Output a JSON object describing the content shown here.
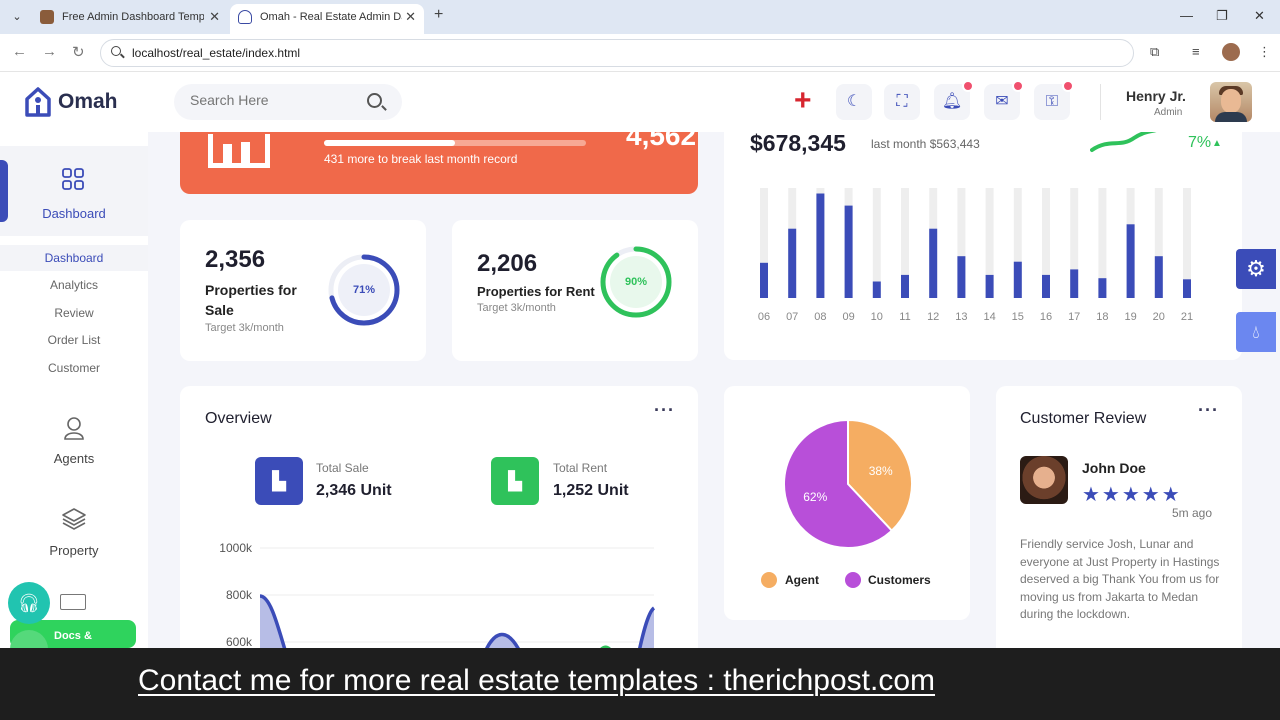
{
  "browser": {
    "tabs": [
      {
        "title": "Free Admin Dashboard Templa",
        "active": false
      },
      {
        "title": "Omah - Real Estate Admin Das",
        "active": true
      }
    ],
    "url": "localhost/real_estate/index.html"
  },
  "header": {
    "brand": "Omah",
    "search_placeholder": "Search Here",
    "user_name": "Henry Jr.",
    "user_role": "Admin"
  },
  "sidebar": {
    "main_item": "Dashboard",
    "subitems": [
      "Dashboard",
      "Analytics",
      "Review",
      "Order List",
      "Customer"
    ],
    "active_subitem": "Dashboard",
    "items": [
      {
        "label": "Agents",
        "icon": "user-icon"
      },
      {
        "label": "Property",
        "icon": "layers-icon"
      }
    ],
    "docs_label": "Docs &"
  },
  "promo": {
    "value_partial": "4,562",
    "progress": 0.5,
    "message": "431 more to break last month record"
  },
  "stats": [
    {
      "value": "2,356",
      "title": "Properties for Sale",
      "target": "Target 3k/month",
      "percent": 71,
      "percent_label": "71%",
      "color": "#3b4cb8"
    },
    {
      "value": "2,206",
      "title": "Properties for Rent",
      "target": "Target 3k/month",
      "percent": 90,
      "percent_label": "90%",
      "color": "#2fc25b"
    }
  ],
  "revenue": {
    "amount": "$678,345",
    "last_month": "last month $563,443",
    "change": "7%"
  },
  "chart_data": [
    {
      "type": "bar",
      "categories": [
        "06",
        "07",
        "08",
        "09",
        "10",
        "11",
        "12",
        "13",
        "14",
        "15",
        "16",
        "17",
        "18",
        "19",
        "20",
        "21"
      ],
      "values": [
        32,
        63,
        95,
        84,
        15,
        21,
        63,
        38,
        21,
        33,
        21,
        26,
        18,
        67,
        38,
        17
      ],
      "ylim": [
        0,
        100
      ],
      "track_color": "#eeeeee",
      "bar_color": "#3b4cb8"
    },
    {
      "type": "pie",
      "labels": [
        "Agent",
        "Customers"
      ],
      "values": [
        38,
        62
      ],
      "colors": [
        "#f5ad62",
        "#b84fd9"
      ]
    },
    {
      "type": "area",
      "ytick_labels": [
        "1000k",
        "800k",
        "600k"
      ],
      "ylim": [
        0,
        1000000
      ]
    }
  ],
  "overview": {
    "title": "Overview",
    "total_sale_label": "Total Sale",
    "total_sale_value": "2,346 Unit",
    "total_rent_label": "Total Rent",
    "total_rent_value": "1,252 Unit"
  },
  "review": {
    "title": "Customer Review",
    "name": "John Doe",
    "stars": "★★★★★",
    "time": "5m ago",
    "text": "Friendly service Josh, Lunar and everyone at Just Property in Hastings deserved a big Thank You from us for moving us from Jakarta to Medan during the lockdown."
  },
  "caption": "Contact me for more real estate templates : therichpost.com"
}
